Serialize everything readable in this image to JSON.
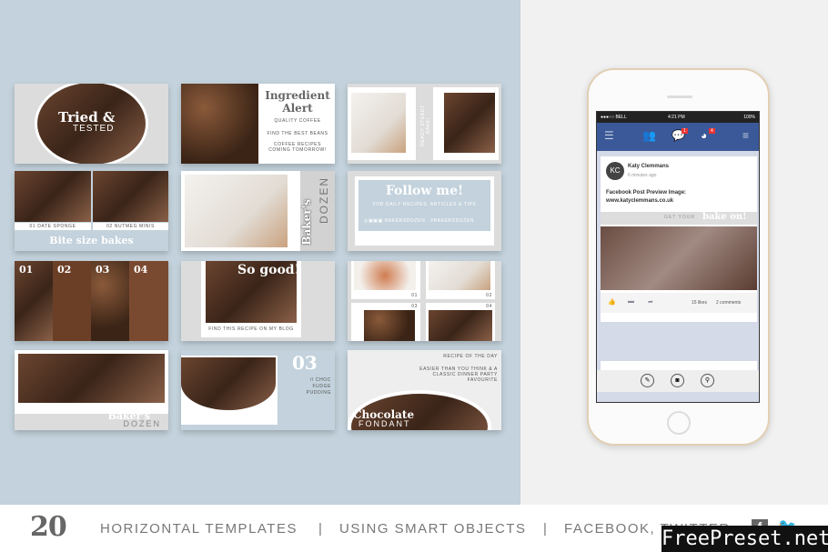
{
  "templates": {
    "tried": {
      "title": "Tried &",
      "sub": "TESTED"
    },
    "ingredient": {
      "title": "Ingredient Alert",
      "l1": "QUALITY COFFEE",
      "l2": "FIND THE BEST BEANS",
      "l3": "COFFEE RECIPES COMING TOMORROW!"
    },
    "ready": {
      "vertical": "READY STEADY BAKE!"
    },
    "bite": {
      "c1": "01 DATE SPONGE",
      "c2": "02 NUTMEG MINIS",
      "title": "Bite size bakes"
    },
    "bakers_vertical": {
      "a": "Baker's",
      "b": "DOZEN"
    },
    "follow": {
      "title": "Follow me!",
      "sub": "FOR DAILY RECIPES, ARTICLES & TIPS",
      "handle": "BAKERSDOZEN",
      "tag": "#BAKERSDOZEN"
    },
    "numbers": [
      "01",
      "02",
      "03",
      "04"
    ],
    "sogood": {
      "title": "So good!",
      "sub": "FIND THIS RECIPE ON MY BLOG"
    },
    "grid": [
      "01",
      "02",
      "03",
      "04"
    ],
    "bakers": {
      "a": "Baker's",
      "b": "DOZEN"
    },
    "choc": {
      "num": "03",
      "l1": "// CHOC",
      "l2": "FUDGE",
      "l3": "PUDDING"
    },
    "fondant": {
      "top": "RECIPE OF THE DAY",
      "desc": "EASIER THAN YOU THINK & A CLASSIC DINNER PARTY FAVOURITE",
      "title": "Chocolate",
      "sub": "FONDANT"
    }
  },
  "phone": {
    "status": {
      "carrier": "●●●○○ BELL",
      "time": "4:21 PM",
      "battery": "100%"
    },
    "badges": {
      "messages": "1",
      "notifications": "4"
    },
    "post": {
      "avatar": "KC",
      "name": "Katy Clemmans",
      "time": "6 minutes ago",
      "text1": "Facebook Post Preview Image:",
      "text2": "www.katyclemmans.co.uk",
      "banner_a": "GET YOUR",
      "banner_b": "bake on!",
      "likes": "15 likes",
      "comments": "2 comments"
    }
  },
  "footer": {
    "count": "20",
    "t1": "HORIZONTAL TEMPLATES",
    "sep": "|",
    "t2": "USING SMART OBJECTS",
    "t3": "FACEBOOK, TWITTER",
    "watermark": "FreePreset.net"
  },
  "colors": {
    "bg_left": "#c3d2dc",
    "facebook_blue": "#3b5998"
  }
}
